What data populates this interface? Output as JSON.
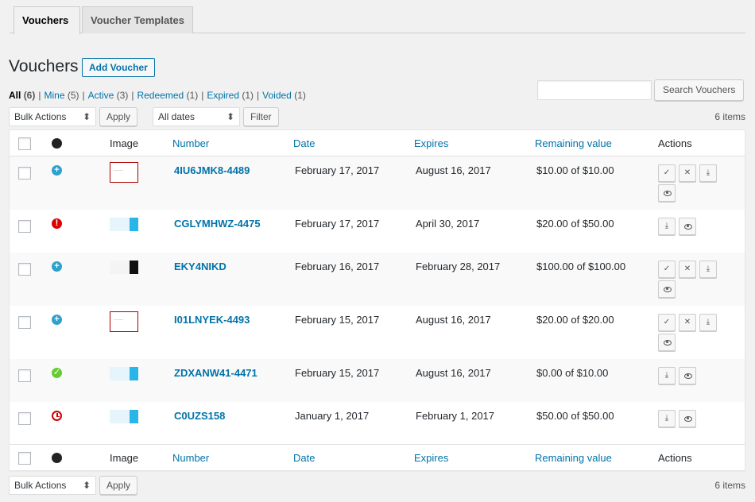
{
  "tabs": [
    {
      "label": "Vouchers",
      "active": true
    },
    {
      "label": "Voucher Templates",
      "active": false
    }
  ],
  "page_title": "Vouchers",
  "add_button": "Add Voucher",
  "filters": {
    "all": {
      "label": "All",
      "count": "(6)"
    },
    "mine": {
      "label": "Mine",
      "count": "(5)"
    },
    "active": {
      "label": "Active",
      "count": "(3)"
    },
    "redeemed": {
      "label": "Redeemed",
      "count": "(1)"
    },
    "expired": {
      "label": "Expired",
      "count": "(1)"
    },
    "voided": {
      "label": "Voided",
      "count": "(1)"
    },
    "separator": "|"
  },
  "search": {
    "value": "",
    "button": "Search Vouchers"
  },
  "top_nav": {
    "bulk": "Bulk Actions",
    "apply": "Apply",
    "dates": "All dates",
    "filter": "Filter",
    "count": "6 items"
  },
  "bottom_nav": {
    "bulk": "Bulk Actions",
    "apply": "Apply",
    "count": "6 items"
  },
  "columns": {
    "image": "Image",
    "number": "Number",
    "date": "Date",
    "expires": "Expires",
    "remaining": "Remaining value",
    "actions": "Actions"
  },
  "action_glyphs": {
    "redeem": "✓",
    "void": "✕",
    "download": "⤓"
  },
  "rows": [
    {
      "status": "plus",
      "thumb": "red",
      "number": "4IU6JMK8-4489",
      "date": "February 17, 2017",
      "expires": "August 16, 2017",
      "remaining": "$10.00 of $10.00",
      "actions": [
        "redeem",
        "void",
        "download",
        "view"
      ]
    },
    {
      "status": "bang",
      "thumb": "blue",
      "number": "CGLYMHWZ-4475",
      "date": "February 17, 2017",
      "expires": "April 30, 2017",
      "remaining": "$20.00 of $50.00",
      "actions": [
        "download",
        "view"
      ]
    },
    {
      "status": "plus",
      "thumb": "black",
      "number": "EKY4NIKD",
      "date": "February 16, 2017",
      "expires": "February 28, 2017",
      "remaining": "$100.00 of $100.00",
      "actions": [
        "redeem",
        "void",
        "download",
        "view"
      ]
    },
    {
      "status": "plus",
      "thumb": "red",
      "number": "I01LNYEK-4493",
      "date": "February 15, 2017",
      "expires": "August 16, 2017",
      "remaining": "$20.00 of $20.00",
      "actions": [
        "redeem",
        "void",
        "download",
        "view"
      ]
    },
    {
      "status": "check",
      "thumb": "blue",
      "number": "ZDXANW41-4471",
      "date": "February 15, 2017",
      "expires": "August 16, 2017",
      "remaining": "$0.00 of $10.00",
      "actions": [
        "download",
        "view"
      ]
    },
    {
      "status": "clock",
      "thumb": "blue",
      "number": "C0UZS158",
      "date": "January 1, 2017",
      "expires": "February 1, 2017",
      "remaining": "$50.00 of $50.00",
      "actions": [
        "download",
        "view"
      ]
    }
  ]
}
